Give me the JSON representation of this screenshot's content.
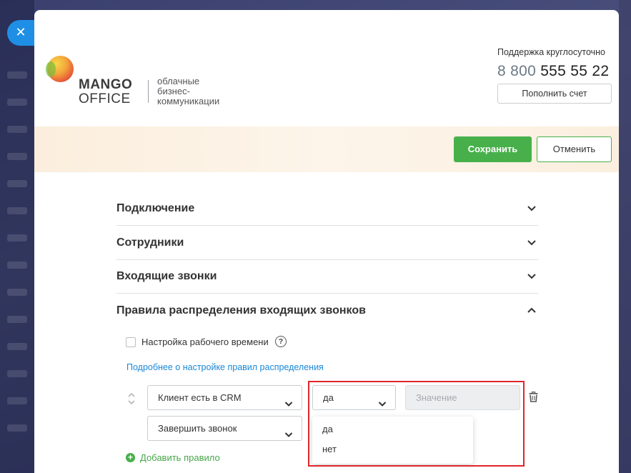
{
  "close": {
    "glyph": "✕"
  },
  "logo": {
    "brand_line1": "MANGO",
    "brand_line2": "OFFICE",
    "tagline_1": "облачные",
    "tagline_2": "бизнес-",
    "tagline_3": "коммуникации"
  },
  "support": {
    "label": "Поддержка круглосуточно",
    "phone_code": "8 800",
    "phone_number": "555 55 22",
    "topup_label": "Пополнить счет"
  },
  "actions": {
    "save_label": "Сохранить",
    "cancel_label": "Отменить"
  },
  "sections": [
    {
      "title": "Подключение",
      "expanded": false
    },
    {
      "title": "Сотрудники",
      "expanded": false
    },
    {
      "title": "Входящие звонки",
      "expanded": false
    },
    {
      "title": "Правила распределения входящих звонков",
      "expanded": true
    }
  ],
  "rules": {
    "working_hours_label": "Настройка рабочего времени",
    "help_glyph": "?",
    "more_link": "Подробнее о настройке правил распределения",
    "condition_value": "Клиент есть в CRM",
    "operator_value": "да",
    "value_placeholder": "Значение",
    "action_value": "Завершить звонок",
    "dropdown_options": [
      "да",
      "нет"
    ],
    "add_rule_label": "Добавить правило",
    "add_rule_glyph": "+"
  },
  "colors": {
    "accent_green": "#47b04b",
    "link_blue": "#1a88d8",
    "highlight_red": "#e0262b",
    "close_blue": "#1f8fe6"
  }
}
